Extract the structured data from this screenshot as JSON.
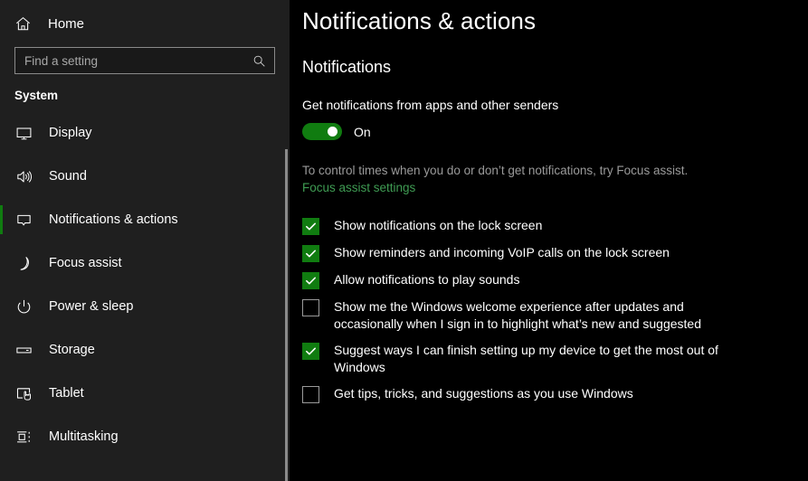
{
  "sidebar": {
    "home": {
      "label": "Home",
      "icon": "home-icon"
    },
    "search": {
      "placeholder": "Find a setting",
      "value": "",
      "icon": "search-icon"
    },
    "group_title": "System",
    "items": [
      {
        "label": "Display",
        "icon": "monitor-icon",
        "selected": false
      },
      {
        "label": "Sound",
        "icon": "speaker-icon",
        "selected": false
      },
      {
        "label": "Notifications & actions",
        "icon": "chat-bubble-icon",
        "selected": true
      },
      {
        "label": "Focus assist",
        "icon": "moon-icon",
        "selected": false
      },
      {
        "label": "Power & sleep",
        "icon": "power-icon",
        "selected": false
      },
      {
        "label": "Storage",
        "icon": "drive-icon",
        "selected": false
      },
      {
        "label": "Tablet",
        "icon": "tablet-hand-icon",
        "selected": false
      },
      {
        "label": "Multitasking",
        "icon": "task-view-icon",
        "selected": false
      }
    ]
  },
  "main": {
    "page_title": "Notifications & actions",
    "section_title": "Notifications",
    "setting_label": "Get notifications from apps and other senders",
    "toggle": {
      "state_label": "On",
      "on": true
    },
    "hint_text": "To control times when you do or don’t get notifications, try Focus assist.",
    "link_label": "Focus assist settings",
    "checkboxes": [
      {
        "label": "Show notifications on the lock screen",
        "checked": true
      },
      {
        "label": "Show reminders and incoming VoIP calls on the lock screen",
        "checked": true
      },
      {
        "label": "Allow notifications to play sounds",
        "checked": true
      },
      {
        "label": "Show me the Windows welcome experience after updates and occasionally when I sign in to highlight what’s new and suggested",
        "checked": false
      },
      {
        "label": "Suggest ways I can finish setting up my device to get the most out of Windows",
        "checked": true
      },
      {
        "label": "Get tips, tricks, and suggestions as you use Windows",
        "checked": false
      }
    ]
  },
  "colors": {
    "accent_green": "#107C10",
    "link_green": "#3f9c53",
    "sidebar_bg": "#1f1f1f",
    "main_bg": "#000000",
    "hint_text": "#9a9a9a"
  }
}
